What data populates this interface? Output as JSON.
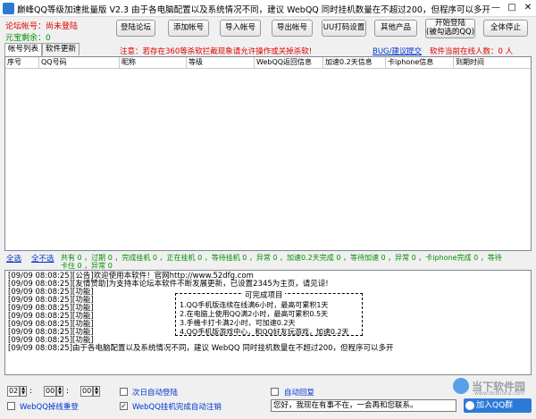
{
  "window": {
    "title": "巅峰QQ等级加速批量版 V2.3   由于各电脑配置以及系统情况不同，建议 WebQQ 同时挂机数量在不超过200，但程序可以多开",
    "minimize": "—",
    "maximize": "□",
    "close": "✕"
  },
  "info": {
    "forum_account_label": "论坛帐号：尚未登陆",
    "balance_label": "元宝剩余：0"
  },
  "toolbar": {
    "login_forum": "登陆论坛",
    "add_account": "添加帐号",
    "import_account": "导入帐号",
    "export_account": "导出帐号",
    "captcha_settings": "UU打码设置",
    "other_products": "其他产品",
    "start_login_line1": "开始登陆",
    "start_login_line2": "(被勾选的QQ)",
    "stop_all": "全体停止"
  },
  "notice": {
    "warning": "注意：若存在360等杀软拦截现象请允许操作或关掉杀软!",
    "bug_link": "BUG/建议",
    "submit_link": "提交",
    "online_count": "软件当前在线人数：0 人"
  },
  "tabs": [
    {
      "label": "帐号列表"
    },
    {
      "label": "软件更新"
    }
  ],
  "table": {
    "columns": [
      "序号",
      "QQ号码",
      "昵称",
      "等级",
      "WebQQ返回信息",
      "加速0.2天信息",
      "卡iphone信息",
      "到期时间"
    ]
  },
  "status": {
    "select_all": "全选",
    "deselect_all": "全不选",
    "summary_line1": "共有 0 ，过期 0 ，完成挂机 0 ，正在挂机 0 ，等待挂机 0 ，异常 0 ，加速0.2天完成 0 ，等待加速 0 ，异常 0 ，卡iphone完成 0 ，等待",
    "summary_line2": "卡住 0 ，异常 0"
  },
  "log": {
    "lines": [
      "[09/09 08:08:25][公告]欢迎使用本软件！官网http://www.52dfg.com",
      "[09/09 08:08:25][友情赞助]为支持本论坛本软件不断发展更新，已设置2345为主页，请见谅!",
      "[09/09 08:08:25][功能]",
      "[09/09 08:08:25][功能]",
      "[09/09 08:08:25][功能]",
      "[09/09 08:08:25][功能]",
      "[09/09 08:08:25][功能]",
      "[09/09 08:08:25][功能]",
      "[09/09 08:08:25][功能]",
      "[09/09 08:08:25]由于各电脑配置以及系统情况不同，建议 WebQQ 同时挂机数量在不超过200，但程序可以多开"
    ],
    "box_title": "可完成项目",
    "box_items": [
      "1.QQ手机版连续在线满6小时，最高可累积1天",
      "2.在电脑上使用QQ满2小时，最高可累积0.5天",
      "3.手機卡打卡满2小时，可加速0.2天",
      "4.QQ手机版游戏中心，和QQ好友玩游戏，加速0.2天"
    ]
  },
  "schedule": {
    "hour": "02",
    "minute": "00",
    "second": "00",
    "separator": ":",
    "auto_login_next_day": "次日自动登陆",
    "auto_reply": "自动回复",
    "webqq_drop_relogin": "WebQQ掉线重登",
    "auto_logout_after_done": "WebQQ挂机完成自动注销",
    "auto_logout_checked": "✓",
    "reply_text": "您好，我现在有事不在，一会再和您联系。"
  },
  "watermark": {
    "site_name": "当下软件园",
    "site_domain": "www.downxia.com",
    "qq_group": "加入QQ群"
  },
  "colors": {
    "red": "#e00000",
    "green": "#009000",
    "blue": "#0033cc",
    "title_icon": "#2b7bd6"
  }
}
